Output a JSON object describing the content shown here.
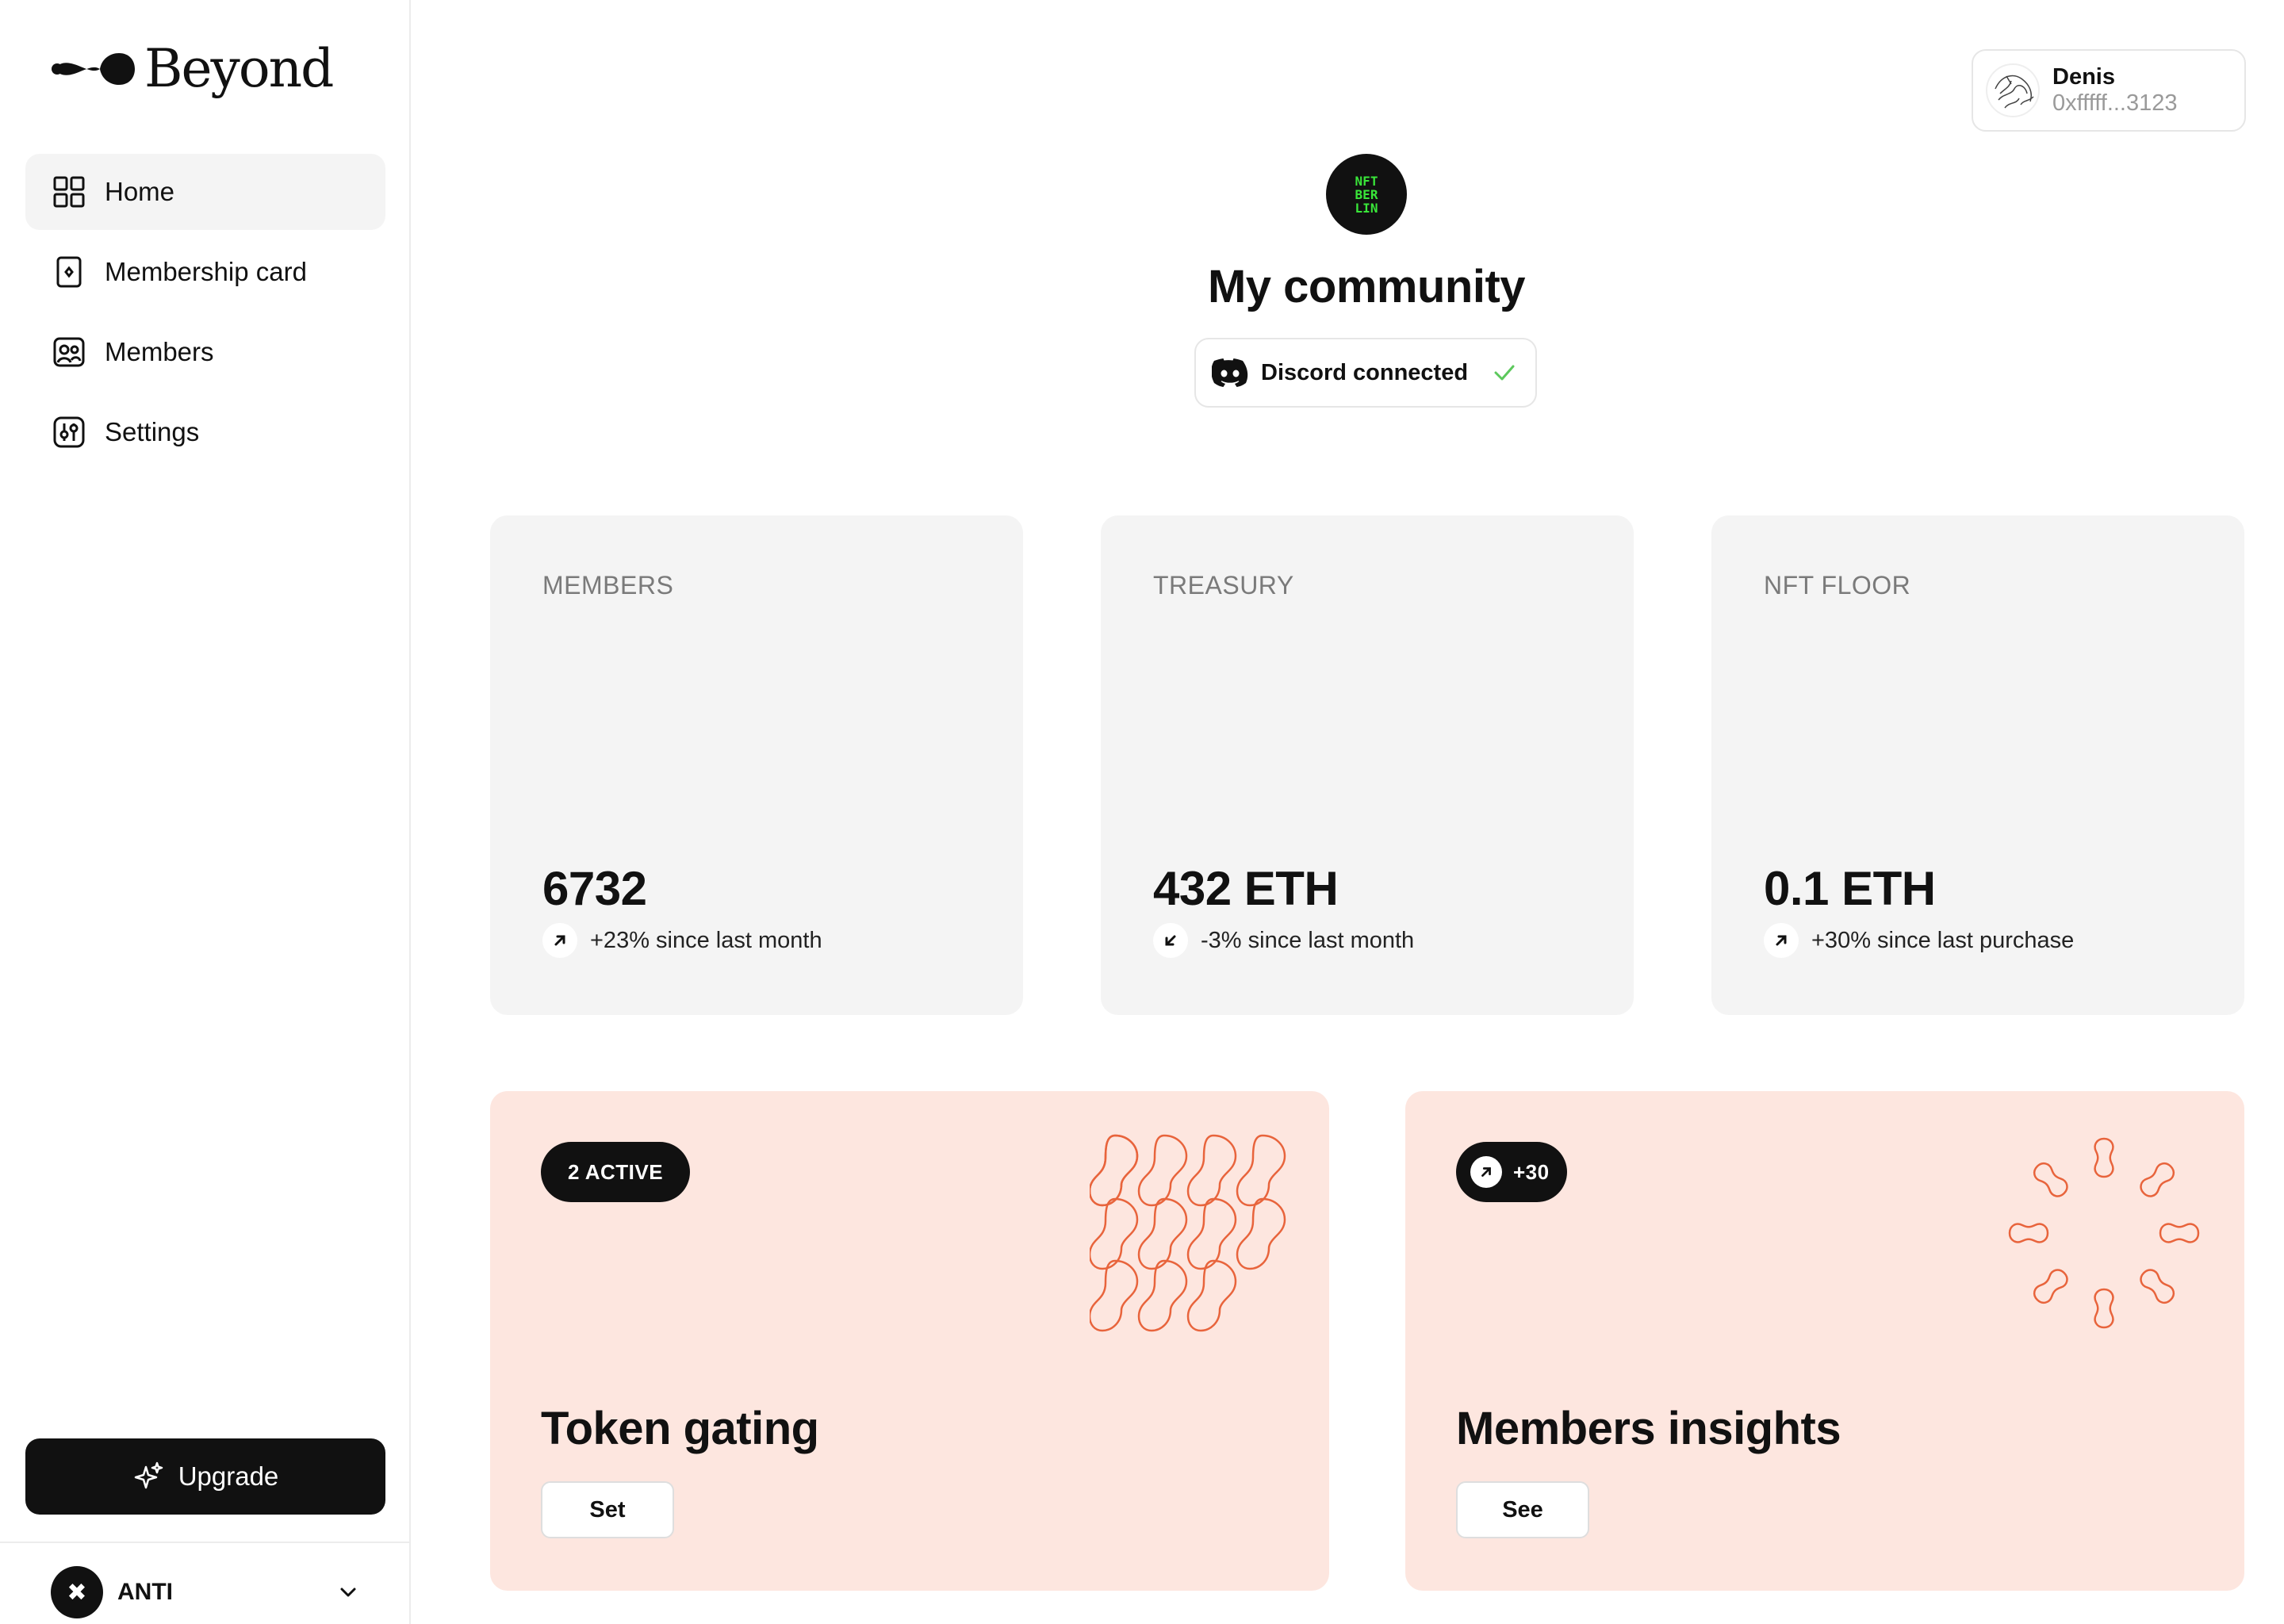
{
  "app": {
    "brand": "Beyond"
  },
  "sidebar": {
    "items": [
      {
        "label": "Home",
        "icon": "grid-icon",
        "active": true
      },
      {
        "label": "Membership card",
        "icon": "card-icon",
        "active": false
      },
      {
        "label": "Members",
        "icon": "members-icon",
        "active": false
      },
      {
        "label": "Settings",
        "icon": "settings-icon",
        "active": false
      }
    ],
    "upgrade_label": "Upgrade",
    "account": {
      "name": "ANTI",
      "avatar_glyph": "✖"
    }
  },
  "user": {
    "name": "Denis",
    "address": "0xfffff...3123"
  },
  "community": {
    "title": "My community",
    "discord_label": "Discord connected",
    "logo_text": "NFT BER LIN"
  },
  "stats": [
    {
      "label": "MEMBERS",
      "value": "6732",
      "change": "+23% since last month",
      "direction": "up"
    },
    {
      "label": "TREASURY",
      "value": "432 ETH",
      "change": "-3% since last month",
      "direction": "down"
    },
    {
      "label": "NFT FLOOR",
      "value": "0.1 ETH",
      "change": "+30% since last purchase",
      "direction": "up"
    }
  ],
  "features": [
    {
      "pill": "2 ACTIVE",
      "title": "Token gating",
      "button": "Set"
    },
    {
      "pill": "+30",
      "title": "Members insights",
      "button": "See"
    }
  ],
  "colors": {
    "accent_dark": "#111111",
    "card_gray": "#f4f4f4",
    "feature_peach": "#fde6df",
    "feature_line": "#e8643c",
    "check_green": "#5cc85c",
    "logo_green": "#39e639"
  }
}
